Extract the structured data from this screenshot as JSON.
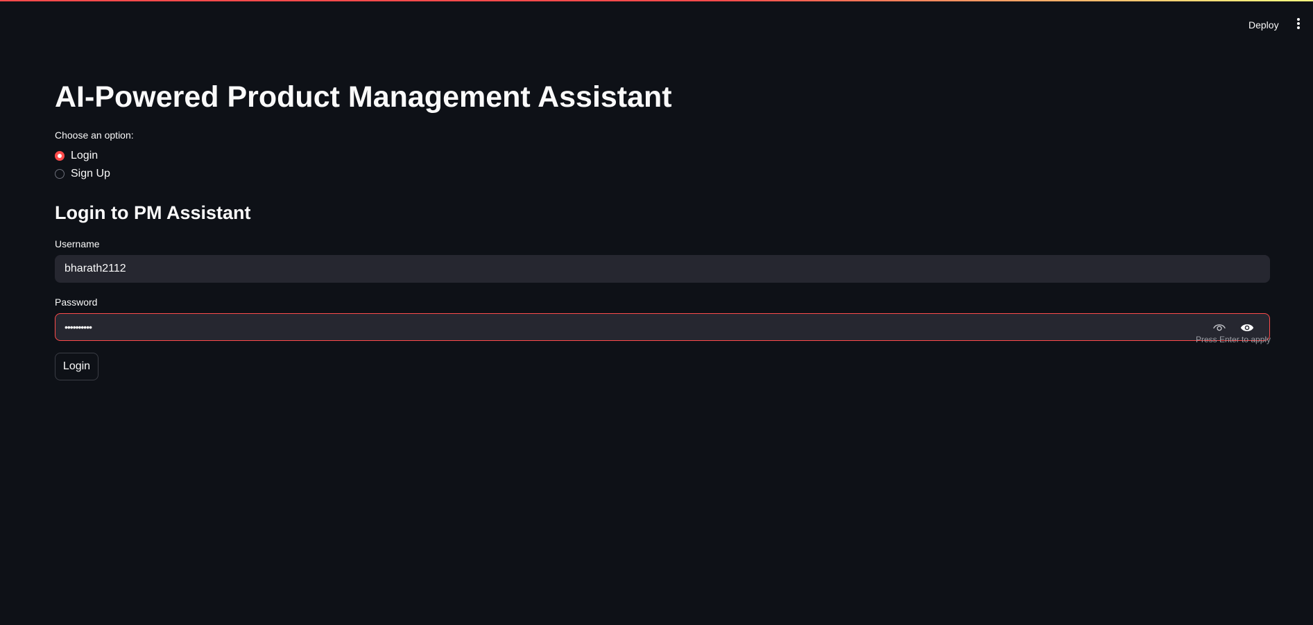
{
  "header": {
    "deploy_label": "Deploy",
    "menu_icon": "vertical-ellipsis-icon"
  },
  "main": {
    "title": "AI-Powered Product Management Assistant",
    "option_prompt": "Choose an option:",
    "options": [
      {
        "label": "Login",
        "selected": true
      },
      {
        "label": "Sign Up",
        "selected": false
      }
    ],
    "subheader": "Login to PM Assistant",
    "username": {
      "label": "Username",
      "value": "bharath2112"
    },
    "password": {
      "label": "Password",
      "value": "••••••••••",
      "hint": "Press Enter to apply"
    },
    "login_button": "Login"
  },
  "colors": {
    "background": "#0e1117",
    "accent": "#ff4b4b",
    "input_bg": "#262730",
    "text": "#fafafa"
  }
}
